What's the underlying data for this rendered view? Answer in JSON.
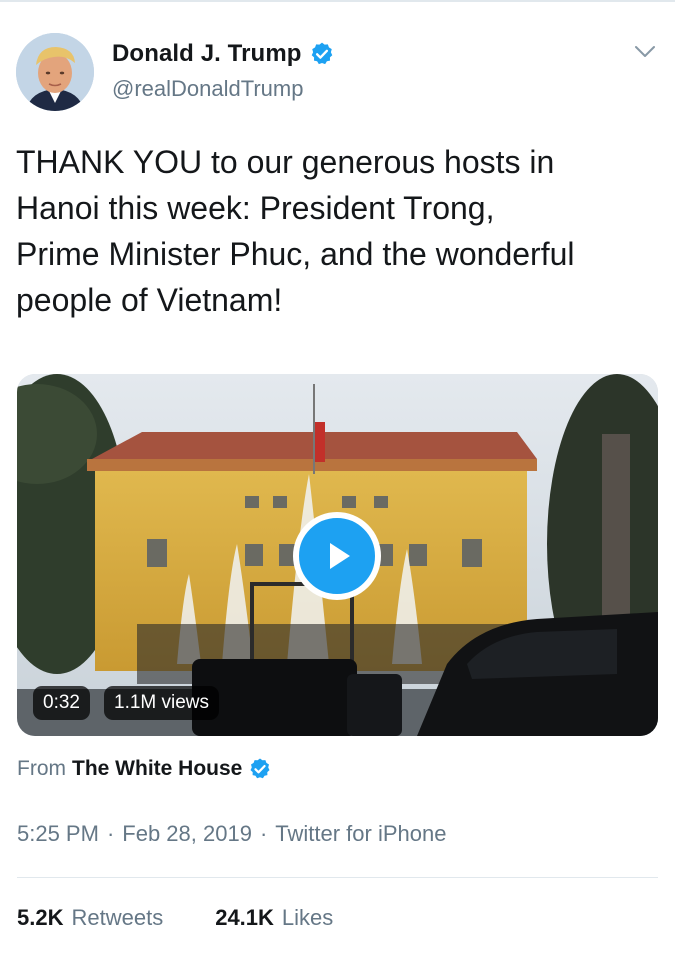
{
  "author": {
    "name": "Donald J. Trump",
    "handle": "@realDonaldTrump"
  },
  "tweet": {
    "text": "THANK YOU to our generous hosts in Hanoi this week: President Trong, Prime Minister Phuc, and the wonderful people of Vietnam!",
    "lines": [
      "THANK YOU to our generous hosts in",
      "Hanoi this week: President Trong,",
      "Prime Minister Phuc, and the wonderful",
      "people of Vietnam!"
    ]
  },
  "video": {
    "duration": "0:32",
    "views": "1.1M views"
  },
  "source": {
    "prefix": "From",
    "account": "The White House"
  },
  "meta": {
    "time": "5:25 PM",
    "date": "Feb 28, 2019",
    "client": "Twitter for iPhone",
    "separator": "·"
  },
  "stats": {
    "retweets_count": "5.2K",
    "retweets_label": "Retweets",
    "likes_count": "24.1K",
    "likes_label": "Likes"
  },
  "colors": {
    "accent": "#1da1f2",
    "text": "#14171a",
    "muted": "#657786",
    "divider": "#e1e8ed"
  },
  "icons": {
    "verified": "verified-badge-icon",
    "more": "chevron-down-icon",
    "play": "play-icon"
  }
}
